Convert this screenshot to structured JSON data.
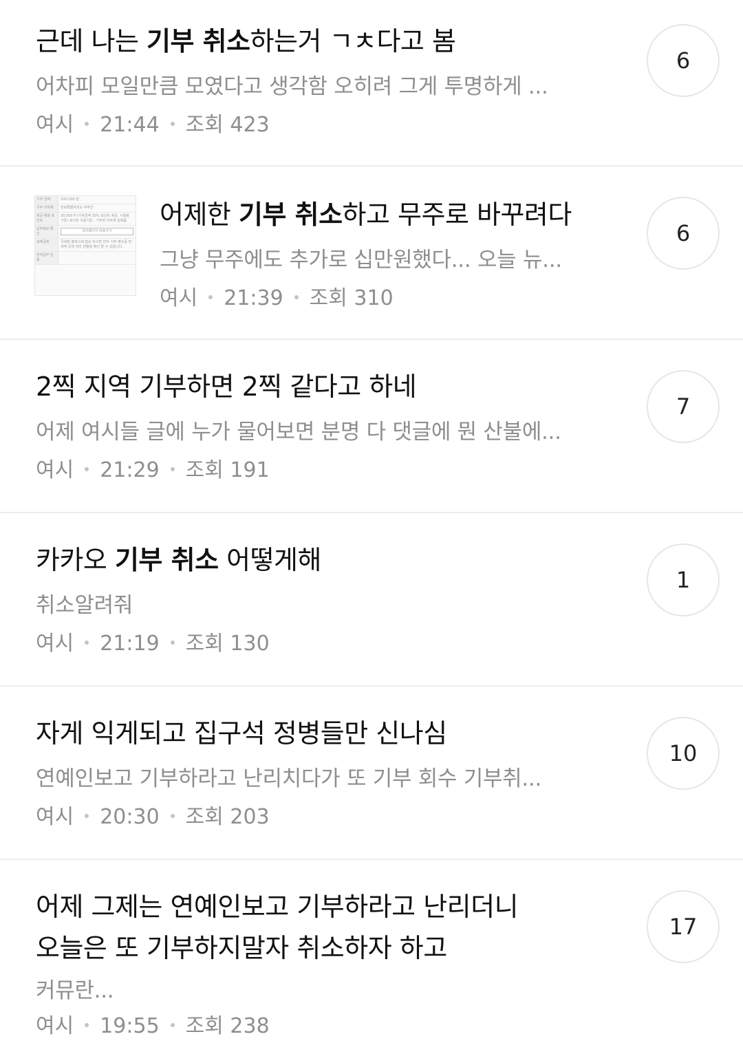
{
  "posts": [
    {
      "title_pre": "근데 나는 ",
      "title_bold": "기부 취소",
      "title_post": "하는거 ㄱㅊ다고 봄",
      "excerpt": "어차피 모일만큼 모였다고 생각함 오히려 그게 투명하게 ...",
      "author": "여시",
      "time": "21:44",
      "views_label": "조회",
      "views": "423",
      "comments": "6"
    },
    {
      "title_pre": "어제한 ",
      "title_bold": "기부 취소",
      "title_post": "하고 무주로 바꾸려다",
      "excerpt": "그냥 무주에도 추가로 십만원했다... 오늘 뉴...",
      "author": "여시",
      "time": "21:39",
      "views_label": "조회",
      "views": "310",
      "comments": "6",
      "thumbnail": {
        "rows": [
          {
            "k": "기부 금액",
            "v": "100,000 원"
          },
          {
            "k": "기부 지자체",
            "v": "전북특별자치도 무주군"
          },
          {
            "k": "제공 예정 포인트",
            "v": "30,000 P (기부금액 30% 포인트 제공, 시행령 기준) 포인트 사용기준 : 기부한 지자체 답례품"
          },
          {
            "k": "납부정보 확인",
            "v": "",
            "button": "마이페이지 바로가기"
          },
          {
            "k": "세액공제",
            "v": "국세청 홈택스에 접속 하시면 전자 기부 영수증 및 세액 공제 처리 현황을 확인 할 수 있습니다."
          },
          {
            "k": "전자납부 번호",
            "v": ""
          }
        ]
      }
    },
    {
      "title_pre": "2찍 지역 기부하면 2찍 같다고 하네",
      "title_bold": "",
      "title_post": "",
      "excerpt": "어제 여시들 글에 누가 물어보면 분명 다 댓글에 뭔 산불에...",
      "author": "여시",
      "time": "21:29",
      "views_label": "조회",
      "views": "191",
      "comments": "7"
    },
    {
      "title_pre": "카카오 ",
      "title_bold": "기부 취소",
      "title_post": " 어떻게해",
      "excerpt": "취소알려줘",
      "author": "여시",
      "time": "21:19",
      "views_label": "조회",
      "views": "130",
      "comments": "1"
    },
    {
      "title_pre": "자게 익게되고 집구석 정병들만 신나심",
      "title_bold": "",
      "title_post": "",
      "excerpt": "연예인보고 기부하라고 난리치다가 또 기부 회수 기부취...",
      "author": "여시",
      "time": "20:30",
      "views_label": "조회",
      "views": "203",
      "comments": "10"
    },
    {
      "title_line1": "어제 그제는 연예인보고 기부하라고 난리더니",
      "title_line2": "오늘은 또 기부하지말자 취소하자 하고",
      "excerpt": "커뮤란...",
      "author": "여시",
      "time": "19:55",
      "views_label": "조회",
      "views": "238",
      "comments": "17"
    }
  ]
}
